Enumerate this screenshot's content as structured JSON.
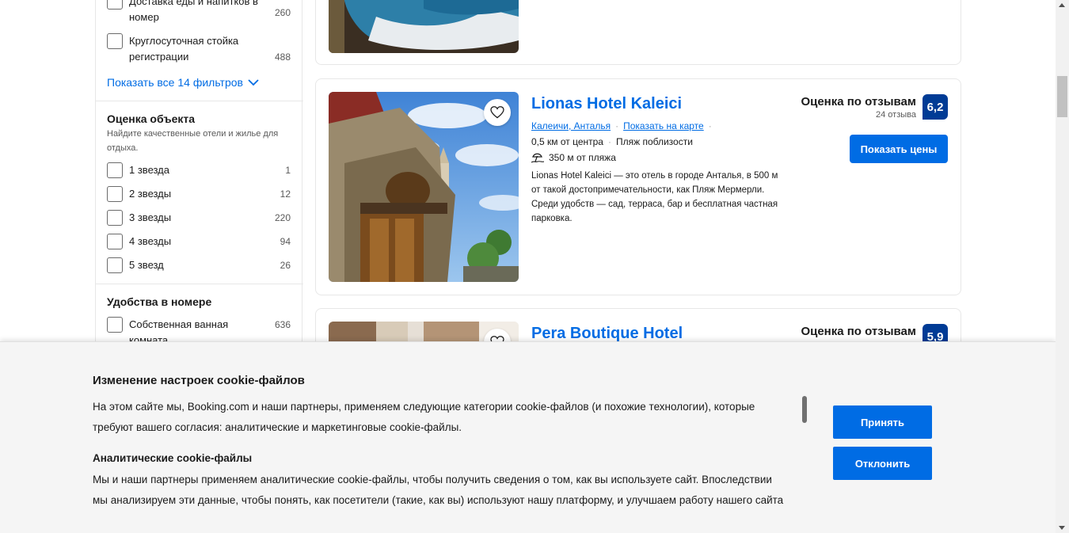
{
  "sidebar": {
    "facility_filters": [
      {
        "label": "Доставка еды и напитков в номер",
        "count": "260"
      },
      {
        "label": "Круглосуточная стойка регистрации",
        "count": "488"
      }
    ],
    "show_all_label": "Показать все 14 фильтров",
    "rating_group": {
      "title": "Оценка объекта",
      "description": "Найдите качественные отели и жилье для отдыха.",
      "items": [
        {
          "label": "1 звезда",
          "count": "1"
        },
        {
          "label": "2 звезды",
          "count": "12"
        },
        {
          "label": "3 звезды",
          "count": "220"
        },
        {
          "label": "4 звезды",
          "count": "94"
        },
        {
          "label": "5 звезд",
          "count": "26"
        }
      ]
    },
    "room_group": {
      "title": "Удобства в номере",
      "items": [
        {
          "label": "Собственная ванная комната",
          "count": "636"
        }
      ]
    }
  },
  "hotels": [
    {
      "name": "Lionas Hotel Kaleici",
      "location_link": "Калеичи, Анталья",
      "map_link": "Показать на карте",
      "distance": "0,5 км от центра",
      "beach_tag": "Пляж поблизости",
      "beach_distance": "350 м от пляжа",
      "description": "Lionas Hotel Kaleici — это отель в городе Анталья, в 500 м от такой достопримечательности, как Пляж Мермерли. Среди удобств — сад, терраса, бар и бесплатная частная парковка.",
      "rating_label": "Оценка по отзывам",
      "review_count": "24 отзыва",
      "score": "6,2",
      "button_label": "Показать цены"
    },
    {
      "name": "Pera Boutique Hotel",
      "rating_label": "Оценка по отзывам",
      "score": "5,9"
    }
  ],
  "cookie": {
    "title": "Изменение настроек cookie-файлов",
    "text_line1": "На этом сайте мы, Booking.com и наши партнеры, применяем следующие категории cookie-файлов (и похожие технологии), которые",
    "text_line2": "требуют вашего согласия: аналитические и маркетинговые cookie-файлы.",
    "analytics_title": "Аналитические cookie-файлы",
    "analytics_line1": "Мы и наши партнеры применяем аналитические cookie-файлы, чтобы получить сведения о том, как вы используете сайт. Впоследствии",
    "analytics_line2": "мы анализируем эти данные, чтобы понять, как посетители (такие, как вы) используют нашу платформу, и улучшаем работу нашего сайта",
    "accept_label": "Принять",
    "reject_label": "Отклонить"
  },
  "colors": {
    "accent": "#006ce4",
    "score_bg": "#003b95"
  }
}
